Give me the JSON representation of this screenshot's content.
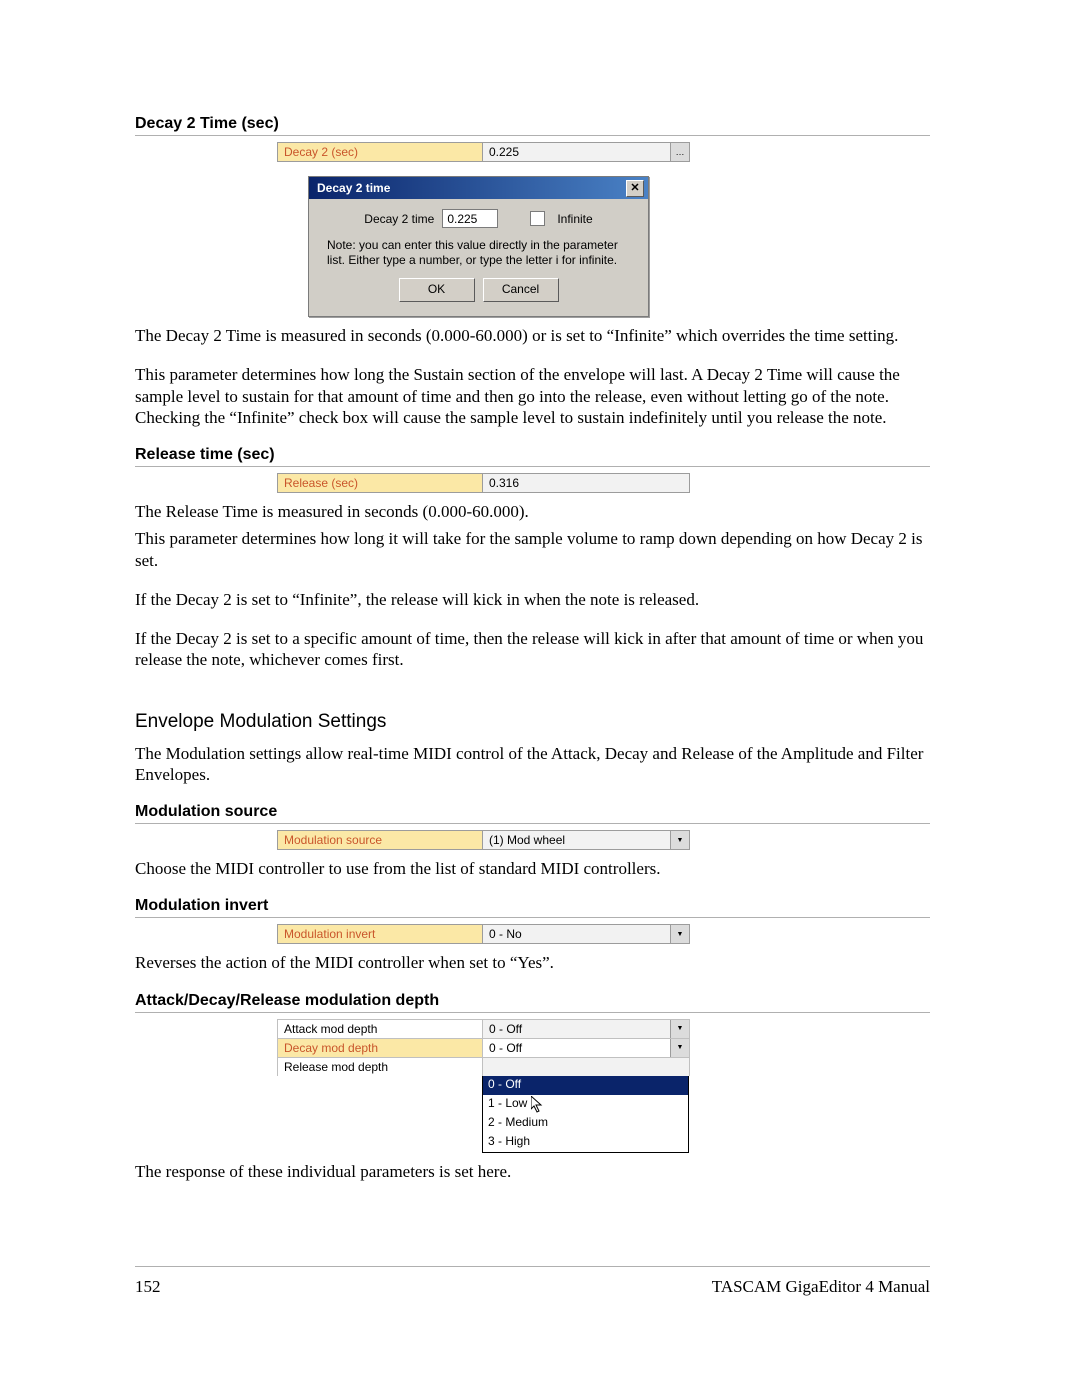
{
  "section1": {
    "title": "Decay 2 Time (sec)",
    "param": {
      "label": "Decay 2 (sec)",
      "value": "0.225",
      "more": "…"
    },
    "popup": {
      "title": "Decay 2 time",
      "field_label": "Decay 2 time",
      "field_value": "0.225",
      "checkbox_label": "Infinite",
      "note": "Note: you can enter this value directly in the parameter list.  Either type a number, or type the letter i for infinite.",
      "ok": "OK",
      "cancel": "Cancel"
    },
    "p1": "The Decay 2 Time is measured in seconds (0.000-60.000) or is set to “Infinite” which overrides the time setting.",
    "p2": "This parameter determines how long the Sustain section of the envelope will last.  A Decay 2 Time will cause the sample level to sustain for that amount of time and then go into the release, even without letting go of the note.  Checking the “Infinite” check box will cause the sample level to sustain indefinitely until you release the note."
  },
  "section2": {
    "title": "Release time (sec)",
    "param": {
      "label": "Release (sec)",
      "value": "0.316"
    },
    "p1": "The Release Time is measured in seconds (0.000-60.000).",
    "p2": "This parameter determines how long it will take for the sample volume to ramp down depending on how Decay 2 is set.",
    "p3": "If the Decay 2 is set to “Infinite”, the release will kick in when the note is released.",
    "p4": "If the Decay 2 is set to a specific amount of time, then the release will kick in after that amount of time or when you release the note, whichever comes first."
  },
  "section3": {
    "title": "Envelope Modulation Settings",
    "intro": "The Modulation settings allow real-time MIDI control of the Attack, Decay and Release of the Amplitude and Filter Envelopes.",
    "sub1": {
      "title": "Modulation source",
      "param": {
        "label": "Modulation source",
        "value": "(1) Mod wheel"
      },
      "p": "Choose the MIDI controller to use from the list of standard MIDI controllers."
    },
    "sub2": {
      "title": "Modulation invert",
      "param": {
        "label": "Modulation invert",
        "value": "0 - No"
      },
      "p": "Reverses the action of the MIDI controller when set to “Yes”."
    },
    "sub3": {
      "title": "Attack/Decay/Release modulation depth",
      "rows": [
        {
          "label": "Attack mod depth",
          "value": "0 - Off"
        },
        {
          "label": "Decay mod depth",
          "value": "0 - Off"
        },
        {
          "label": "Release mod depth",
          "value": ""
        }
      ],
      "options": [
        "0 - Off",
        "1 - Low",
        "2 - Medium",
        "3 - High"
      ],
      "p": "The response of these individual parameters is set here."
    }
  },
  "footer": {
    "page": "152",
    "book": "TASCAM GigaEditor 4 Manual"
  }
}
